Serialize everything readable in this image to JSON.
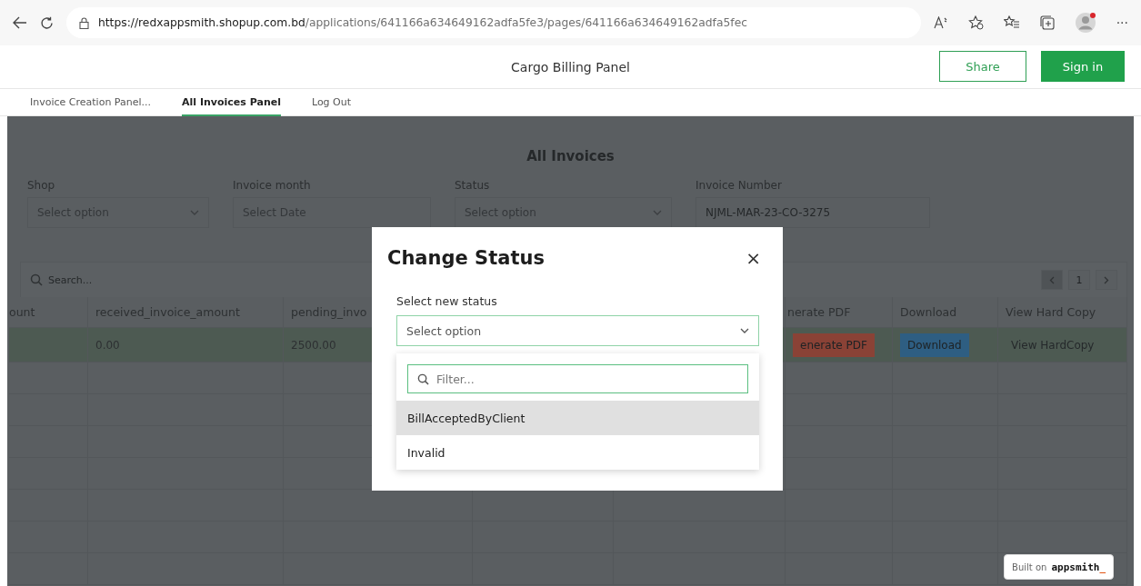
{
  "browser": {
    "url_origin": "https://redxappsmith.shopup.com.bd",
    "url_path": "/applications/641166a634649162adfa5fe3/pages/641166a634649162adfa5fec",
    "menu_glyph": "···"
  },
  "app_header": {
    "title": "Cargo Billing Panel",
    "buttons": [
      {
        "label": "Share",
        "kind": "outline"
      },
      {
        "label": "Sign in",
        "kind": "primary"
      }
    ]
  },
  "tabs": [
    {
      "label": "Invoice Creation Panel...",
      "selected": false
    },
    {
      "label": "All Invoices Panel",
      "selected": true
    },
    {
      "label": "Log Out",
      "selected": false
    }
  ],
  "page": {
    "title": "All Invoices",
    "filters": [
      {
        "label": "Shop",
        "kind": "select",
        "placeholder": "Select option"
      },
      {
        "label": "Invoice month",
        "kind": "date",
        "placeholder": "Select Date"
      },
      {
        "label": "Status",
        "kind": "select",
        "placeholder": "Select option"
      },
      {
        "label": "Invoice Number",
        "kind": "text",
        "value": "NJML-MAR-23-CO-3275"
      }
    ]
  },
  "table": {
    "search_placeholder": "Search...",
    "page": "1",
    "columns": [
      "ount",
      "received_invoice_amount",
      "pending_invo",
      "nerate PDF",
      "Download",
      "View Hard Copy"
    ],
    "rows": [
      {
        "selected": true,
        "cells": [
          {
            "kind": "text",
            "text": ""
          },
          {
            "kind": "text",
            "text": "0.00"
          },
          {
            "kind": "text",
            "text": "2500.00"
          },
          {
            "kind": "button",
            "text": "enerate PDF",
            "color": "#8a4236",
            "disabled": false
          },
          {
            "kind": "button",
            "text": "Download",
            "color": "#2e5e82",
            "disabled": false
          },
          {
            "kind": "button",
            "text": "View HardCopy",
            "disabled": true
          }
        ]
      }
    ]
  },
  "modal": {
    "title": "Change Status",
    "close_glyph": "×",
    "field_label": "Select new status",
    "select_placeholder": "Select option",
    "filter_placeholder": "Filter...",
    "options": [
      {
        "label": "BillAcceptedByClient",
        "highlighted": true
      },
      {
        "label": "Invalid",
        "highlighted": false
      }
    ]
  },
  "badge": {
    "prefix": "Built on",
    "brand": "appsmith",
    "cursor": "_"
  }
}
